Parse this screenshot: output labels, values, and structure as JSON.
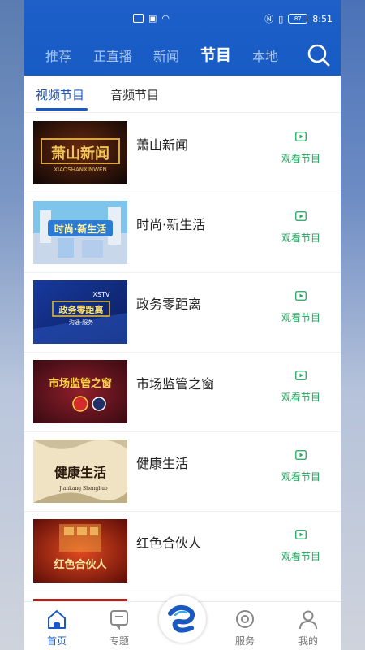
{
  "status_bar": {
    "left_icons": [
      "sim-icon",
      "nfc-icon",
      "wifi-icon"
    ],
    "right_icons": [
      "nfc-icon",
      "vibrate-icon"
    ],
    "battery": "87",
    "time": "8:51"
  },
  "top_tabs": [
    {
      "label": "推荐"
    },
    {
      "label": "正直播"
    },
    {
      "label": "新闻"
    },
    {
      "label": "节目",
      "active": true
    },
    {
      "label": "本地"
    }
  ],
  "sub_tabs": [
    {
      "label": "视频节目",
      "active": true
    },
    {
      "label": "音频节目"
    }
  ],
  "programs": [
    {
      "title": "萧山新闻",
      "thumb_text": "萧山新闻",
      "thumb_sub": "XIAOSHANXINWEN",
      "watch_label": "观看节目"
    },
    {
      "title": "时尚·新生活",
      "thumb_text": "时尚·新生活",
      "watch_label": "观看节目"
    },
    {
      "title": "政务零距离",
      "thumb_text": "政务零距离",
      "thumb_top": "XSTV",
      "thumb_sub": "沟通·服务",
      "watch_label": "观看节目"
    },
    {
      "title": "市场监管之窗",
      "thumb_text": "市场监管之窗",
      "watch_label": "观看节目"
    },
    {
      "title": "健康生活",
      "thumb_text": "健康生活",
      "thumb_sub": "Jiankang Shenghuo",
      "watch_label": "观看节目"
    },
    {
      "title": "红色合伙人",
      "thumb_text": "红色合伙人",
      "watch_label": "观看节目"
    }
  ],
  "bottom_nav": [
    {
      "label": "首页",
      "icon": "home-icon",
      "active": true
    },
    {
      "label": "专题",
      "icon": "topic-icon"
    },
    {
      "label": "服务",
      "icon": "service-icon"
    },
    {
      "label": "我的",
      "icon": "user-icon"
    }
  ],
  "colors": {
    "header_blue": "#1e5fc8",
    "accent_blue": "#1a58c2",
    "watch_green": "#20a55c"
  }
}
